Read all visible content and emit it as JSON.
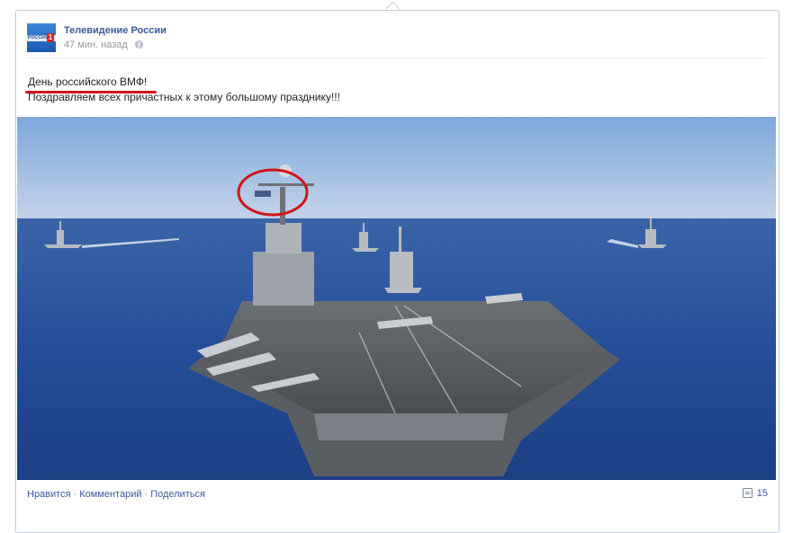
{
  "post": {
    "page_name": "Телевидение России",
    "time": "47 мин. назад",
    "avatar_label": "РОССИЯ",
    "avatar_number": "1",
    "text_line1": "День российского ВМФ!",
    "text_line2": "Поздравляем всех причастных к этому большому празднику!!!",
    "image": {
      "subject": "aircraft carrier with escort ships at sea",
      "highlight_color": "#d0141a"
    }
  },
  "actions": {
    "like": "Нравится",
    "comment": "Комментарий",
    "share": "Поделиться",
    "separator": "·"
  },
  "comments": {
    "count": "15"
  },
  "colors": {
    "link": "#3b5998",
    "meta": "#90949c",
    "border": "#c4cde0",
    "accent_red": "#d0141a"
  }
}
